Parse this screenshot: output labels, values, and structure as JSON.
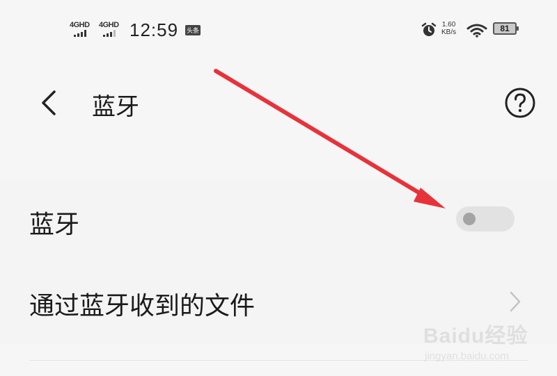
{
  "status_bar": {
    "network_1": "4GHD",
    "network_2": "4GHD",
    "time": "12:59",
    "app_badge": "头条",
    "speed_value": "1.60",
    "speed_unit": "KB/s",
    "battery_level": "81",
    "icons": [
      "signal-icon",
      "alarm-icon",
      "wifi-icon",
      "battery-icon"
    ]
  },
  "header": {
    "title": "蓝牙",
    "back_icon": "chevron-left-icon",
    "help_icon": "help-circle-icon"
  },
  "settings": {
    "bluetooth_label": "蓝牙",
    "bluetooth_enabled": false,
    "received_files_label": "通过蓝牙收到的文件"
  },
  "annotation": {
    "arrow_color": "#e8323a"
  },
  "watermark": {
    "logo": "Baidu经验",
    "url": "jingyan.baidu.com"
  }
}
